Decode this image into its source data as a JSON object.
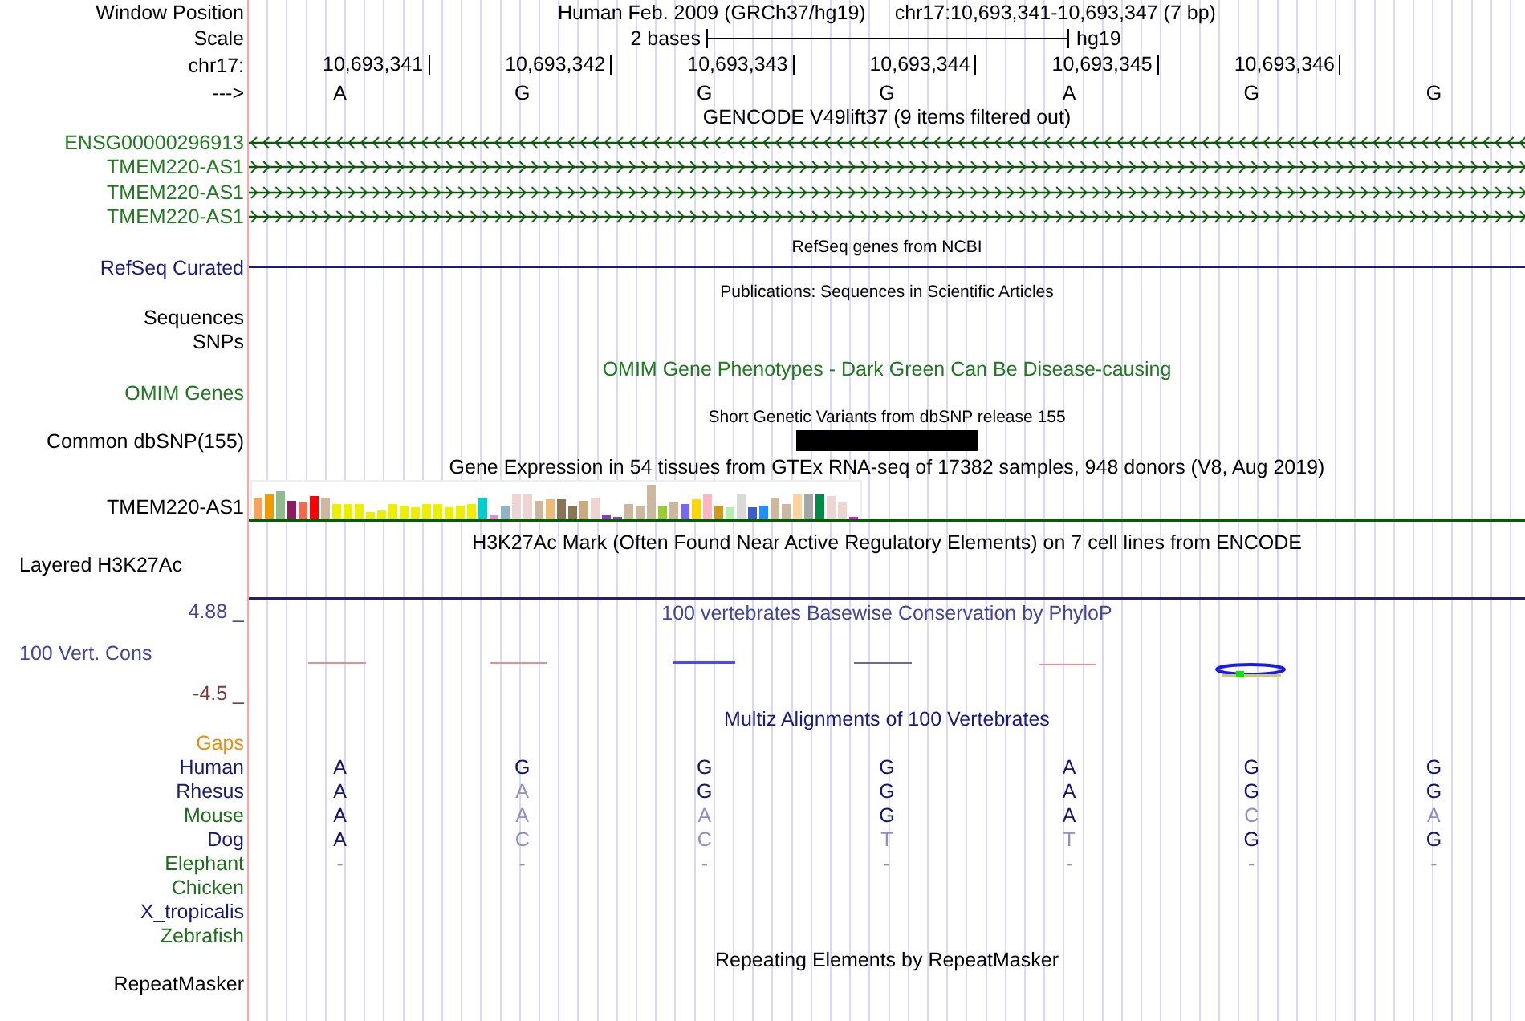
{
  "window_position": {
    "label": "Window Position",
    "assembly": "Human Feb. 2009 (GRCh37/hg19)",
    "range": "chr17:10,693,341-10,693,347 (7 bp)"
  },
  "scale": {
    "label": "Scale",
    "span": "2 bases",
    "assembly": "hg19"
  },
  "ruler": {
    "label": "chr17:",
    "positions": [
      "10,693,341",
      "10,693,342",
      "10,693,343",
      "10,693,344",
      "10,693,345",
      "10,693,346"
    ]
  },
  "sequence": {
    "label": "--->",
    "bases": [
      "A",
      "G",
      "G",
      "G",
      "A",
      "G",
      "G"
    ]
  },
  "gencode": {
    "title": "GENCODE V49lift37 (9 items filtered out)",
    "genes": [
      {
        "name": "ENSG00000296913",
        "reverse_strand": true
      },
      {
        "name": "TMEM220-AS1",
        "reverse_strand": false
      },
      {
        "name": "TMEM220-AS1",
        "reverse_strand": false
      },
      {
        "name": "TMEM220-AS1",
        "reverse_strand": false
      }
    ]
  },
  "refseq": {
    "title": "RefSeq genes from NCBI",
    "label": "RefSeq Curated"
  },
  "publications": {
    "title": "Publications: Sequences in Scientific Articles",
    "labels": [
      "Sequences",
      "SNPs"
    ]
  },
  "omim": {
    "title": "OMIM Gene Phenotypes - Dark Green Can Be Disease-causing",
    "label": "OMIM Genes"
  },
  "dbsnp": {
    "title": "Short Genetic Variants from dbSNP release 155",
    "label": "Common dbSNP(155)",
    "variants": [
      false,
      false,
      false,
      true,
      false,
      false,
      false
    ]
  },
  "gtex": {
    "title": "Gene Expression in 54 tissues from GTEx RNA-seq of 17382 samples, 948 donors (V8, Aug 2019)",
    "label": "TMEM220-AS1"
  },
  "h3k27ac": {
    "title": "H3K27Ac Mark (Often Found Near Active Regulatory Elements) on 7 cell lines from ENCODE",
    "label": "Layered H3K27Ac"
  },
  "phylop": {
    "title": "100 vertebrates Basewise Conservation by PhyloP",
    "label": "100 Vert. Cons",
    "max": "4.88 _",
    "min": "-4.5 _"
  },
  "multiz": {
    "title": "Multiz Alignments of 100 Vertebrates",
    "gaps_label": "Gaps",
    "species": [
      {
        "name": "Human",
        "color": "#1a1a6e",
        "bases": [
          {
            "base": "A",
            "match": true
          },
          {
            "base": "G",
            "match": true
          },
          {
            "base": "G",
            "match": true
          },
          {
            "base": "G",
            "match": true
          },
          {
            "base": "A",
            "match": true
          },
          {
            "base": "G",
            "match": true
          },
          {
            "base": "G",
            "match": true
          }
        ]
      },
      {
        "name": "Rhesus",
        "color": "#1a1a6e",
        "bases": [
          {
            "base": "A",
            "match": true
          },
          {
            "base": "A",
            "match": false
          },
          {
            "base": "G",
            "match": true
          },
          {
            "base": "G",
            "match": true
          },
          {
            "base": "A",
            "match": true
          },
          {
            "base": "G",
            "match": true
          },
          {
            "base": "G",
            "match": true
          }
        ]
      },
      {
        "name": "Mouse",
        "color": "#1c6e1c",
        "bases": [
          {
            "base": "A",
            "match": true
          },
          {
            "base": "A",
            "match": false
          },
          {
            "base": "A",
            "match": false
          },
          {
            "base": "G",
            "match": true
          },
          {
            "base": "A",
            "match": true
          },
          {
            "base": "C",
            "match": false
          },
          {
            "base": "A",
            "match": false
          }
        ]
      },
      {
        "name": "Dog",
        "color": "#1a1a6e",
        "bases": [
          {
            "base": "A",
            "match": true
          },
          {
            "base": "C",
            "match": false
          },
          {
            "base": "C",
            "match": false
          },
          {
            "base": "T",
            "match": false
          },
          {
            "base": "T",
            "match": false
          },
          {
            "base": "G",
            "match": true
          },
          {
            "base": "G",
            "match": true
          }
        ]
      },
      {
        "name": "Elephant",
        "color": "#1c6e1c",
        "bases": [
          {
            "base": "-",
            "match": false
          },
          {
            "base": "-",
            "match": false
          },
          {
            "base": "-",
            "match": false
          },
          {
            "base": "-",
            "match": false
          },
          {
            "base": "-",
            "match": false
          },
          {
            "base": "-",
            "match": false
          },
          {
            "base": "-",
            "match": false
          }
        ]
      },
      {
        "name": "Chicken",
        "color": "#1c6e1c"
      },
      {
        "name": "X_tropicalis",
        "color": "#1a1a6e"
      },
      {
        "name": "Zebrafish",
        "color": "#1c6e1c"
      }
    ]
  },
  "repeatmasker": {
    "title": "Repeating Elements by RepeatMasker",
    "label": "RepeatMasker"
  }
}
